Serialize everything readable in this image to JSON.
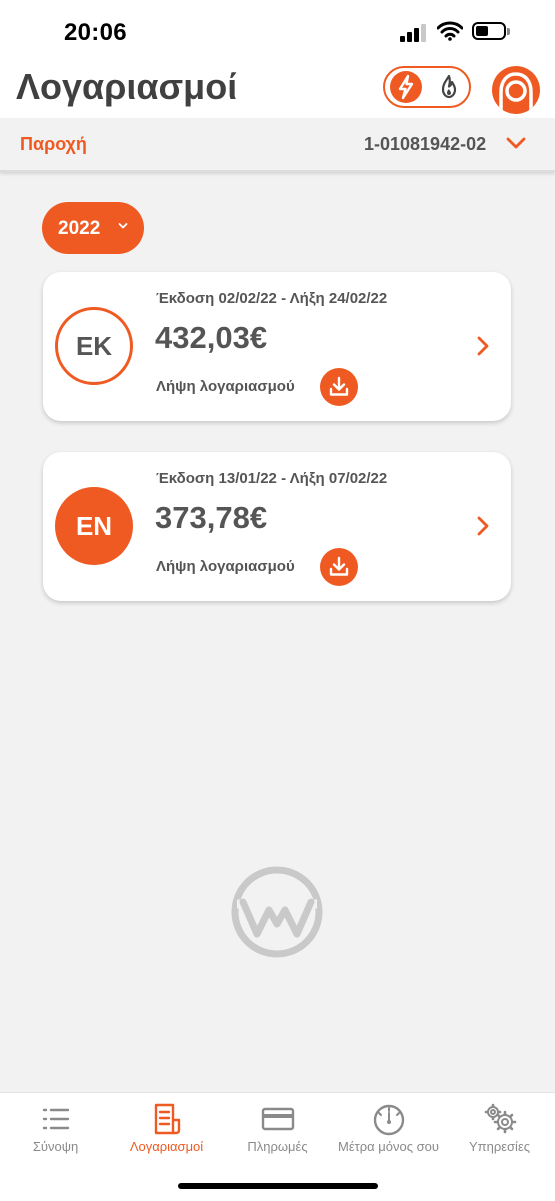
{
  "status_bar": {
    "time": "20:06"
  },
  "header": {
    "title": "Λογαριασμοί"
  },
  "supply": {
    "label": "Παροχή",
    "number": "1-01081942-02"
  },
  "filter": {
    "year": "2022"
  },
  "bills": [
    {
      "badge": "ΕΚ",
      "badge_style": "outline",
      "dates": "Έκδοση 02/02/22 - Λήξη 24/02/22",
      "amount": "432,03€",
      "download_label": "Λήψη λογαριασμού"
    },
    {
      "badge": "ΕΝ",
      "badge_style": "filled",
      "dates": "Έκδοση 13/01/22 - Λήξη 07/02/22",
      "amount": "373,78€",
      "download_label": "Λήψη λογαριασμού"
    }
  ],
  "tabs": [
    {
      "label": "Σύνοψη",
      "icon": "list-icon",
      "active": false
    },
    {
      "label": "Λογαριασμοί",
      "icon": "bills-icon",
      "active": true
    },
    {
      "label": "Πληρωμές",
      "icon": "credit-card-icon",
      "active": false
    },
    {
      "label": "Μέτρα μόνος σου",
      "icon": "meter-gauge-icon",
      "active": false
    },
    {
      "label": "Υπηρεσίες",
      "icon": "gears-icon",
      "active": false
    }
  ],
  "colors": {
    "accent": "#ef5a22",
    "text": "#555555",
    "background": "#f2f2f2",
    "inactive": "#8a8a8a"
  }
}
